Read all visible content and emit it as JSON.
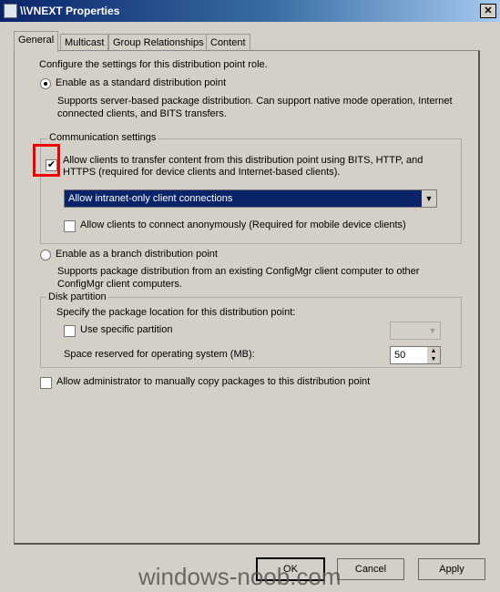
{
  "window": {
    "title": "\\\\VNEXT Properties",
    "close": "✕"
  },
  "tabs": [
    "General",
    "Multicast",
    "Group Relationships",
    "Content"
  ],
  "general": {
    "intro": "Configure the settings for this distribution point role.",
    "standard_label": "Enable as a standard distribution point",
    "standard_desc": "Supports server-based package distribution. Can support native mode operation, Internet connected clients, and BITS transfers.",
    "comm_group": "Communication settings",
    "allow_transfer": "Allow clients to transfer content from this distribution point using BITS, HTTP, and HTTPS (required for device clients and Internet-based clients).",
    "connection_select": "Allow intranet-only client connections",
    "anonymous": "Allow clients to connect anonymously  (Required for mobile device clients)",
    "branch_label": "Enable as a branch distribution point",
    "branch_desc": "Supports package distribution from an existing ConfigMgr client computer to other ConfigMgr client computers.",
    "disk_group": "Disk partition",
    "disk_desc": "Specify the package location for this distribution point:",
    "use_partition": "Use specific partition",
    "space_label": "Space reserved for operating system (MB):",
    "space_value": "50",
    "manual_copy": "Allow administrator to manually copy packages to this distribution point"
  },
  "buttons": {
    "ok": "OK",
    "cancel": "Cancel",
    "apply": "Apply"
  },
  "watermark": "windows-noob.com"
}
